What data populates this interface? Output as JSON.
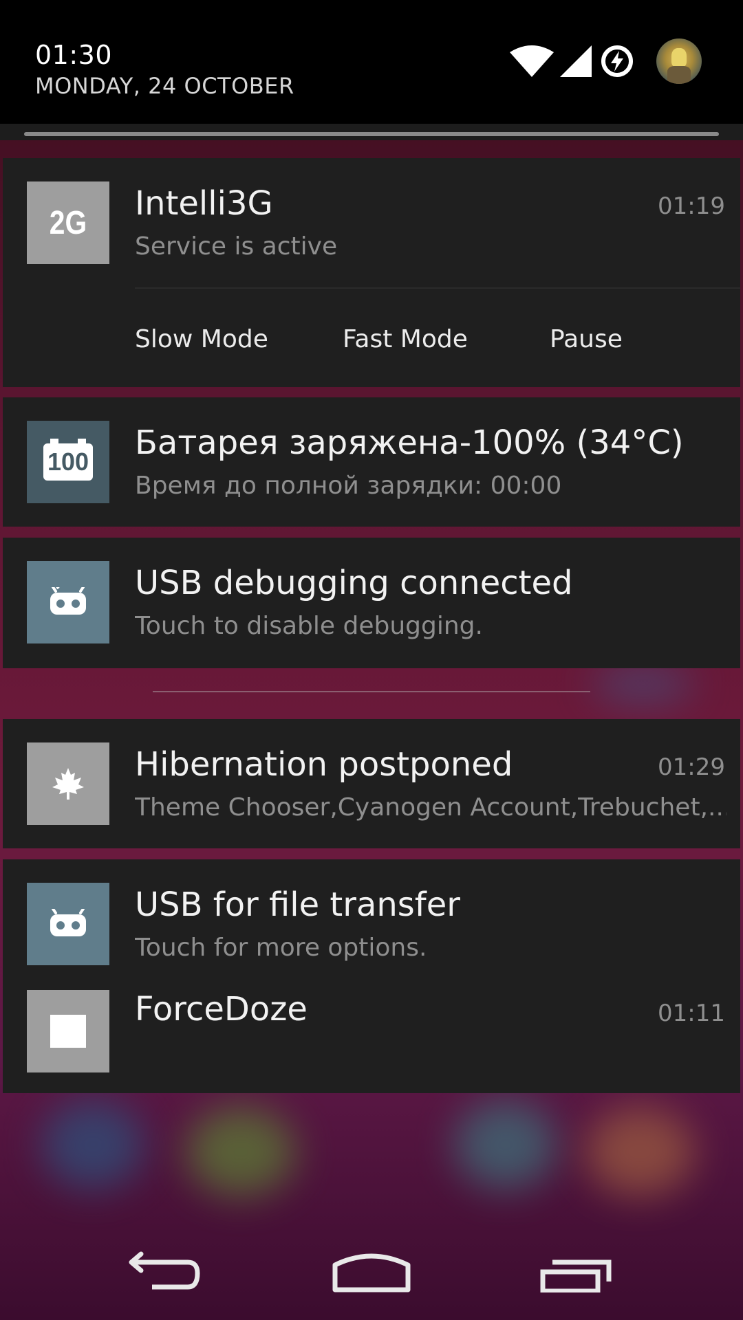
{
  "status": {
    "time": "01:30",
    "date": "MONDAY, 24 OCTOBER"
  },
  "notifications": [
    {
      "app": "intelli3g",
      "icon_label": "2G",
      "icon_bg": "#9e9e9e",
      "title": "Intelli3G",
      "text": "Service is active",
      "time": "01:19",
      "actions": [
        "Slow Mode",
        "Fast Mode",
        "Pause"
      ]
    },
    {
      "app": "battery",
      "icon_label": "100",
      "icon_bg": "#455a64",
      "title": "Батарея заряжена-100% (34°C)",
      "text": "Время до полной зарядки: 00:00"
    },
    {
      "app": "usb-debugging",
      "icon_bg": "#607d8b",
      "title": "USB debugging connected",
      "text": "Touch to disable debugging."
    },
    {
      "app": "hibernation",
      "icon_bg": "#9e9e9e",
      "title": "Hibernation postponed",
      "text": "Theme Chooser,Cyanogen Account,Trebuchet,...",
      "time": "01:29"
    },
    {
      "app": "usb-file-transfer",
      "icon_bg": "#607d8b",
      "title": "USB for file transfer",
      "text": "Touch for more options."
    },
    {
      "app": "forcedoze",
      "icon_bg": "#9e9e9e",
      "title": "ForceDoze",
      "time": "01:11"
    }
  ],
  "icons": {
    "wifi": "wifi-icon",
    "signal": "cell-signal-icon",
    "battery": "battery-charging-icon",
    "avatar": "user-avatar",
    "back": "back-icon",
    "home": "home-icon",
    "recents": "recents-icon"
  }
}
